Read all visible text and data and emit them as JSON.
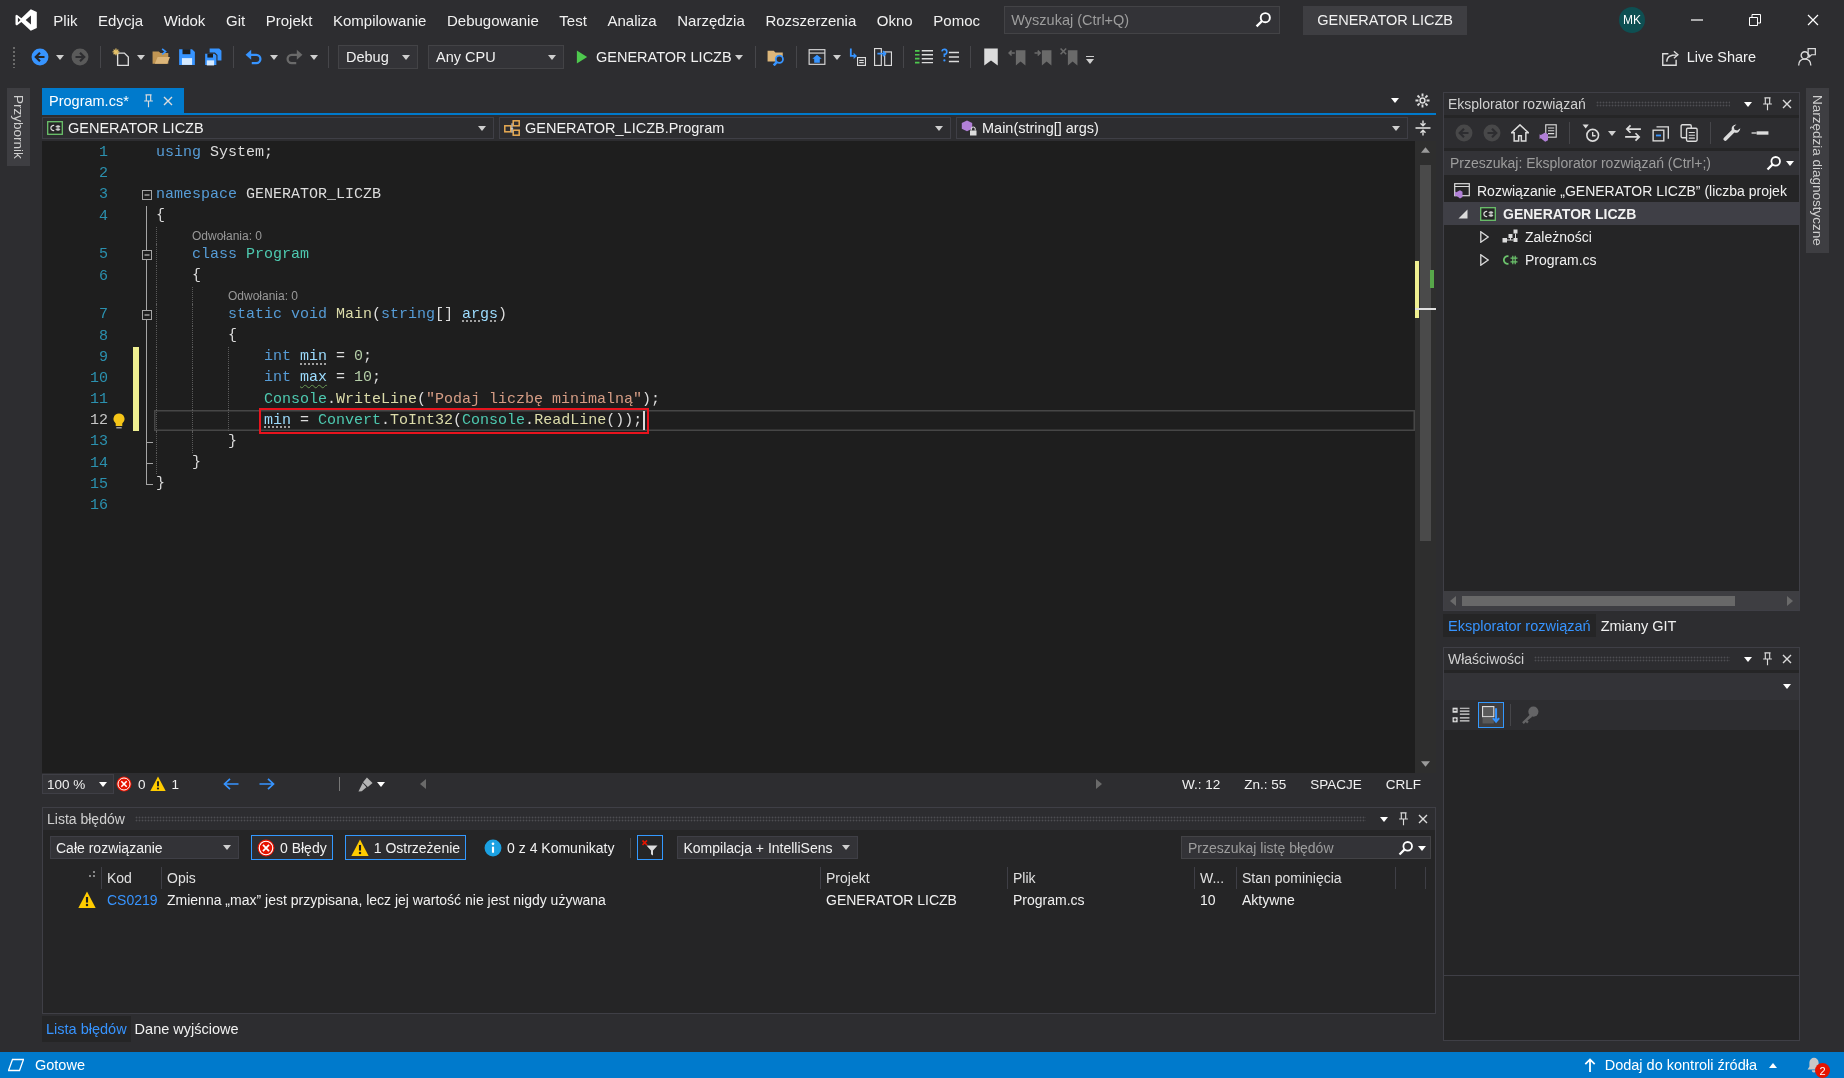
{
  "title_bar": {
    "menu": [
      "Plik",
      "Edycja",
      "Widok",
      "Git",
      "Projekt",
      "Kompilowanie",
      "Debugowanie",
      "Test",
      "Analiza",
      "Narzędzia",
      "Rozszerzenia",
      "Okno",
      "Pomoc"
    ],
    "search": {
      "placeholder": "Wyszukaj (Ctrl+Q)"
    },
    "solution_name": "GENERATOR LICZB",
    "avatar": "MK"
  },
  "toolbar": {
    "configuration": "Debug",
    "platform": "Any CPU",
    "start_target": "GENERATOR LICZB",
    "live_share": "Live Share"
  },
  "left_rail": {
    "label": "Przybornik"
  },
  "document_tabs": [
    {
      "label": "Program.cs*",
      "selected": true
    }
  ],
  "navigation_bar": {
    "project": "GENERATOR LICZB",
    "type": "GENERATOR_LICZB.Program",
    "member": "Main(string[] args)"
  },
  "editor": {
    "lines": [
      {
        "kind": "code",
        "number": "1",
        "modified": false,
        "tokens": [
          {
            "text": "using",
            "kind": "keyword"
          },
          {
            "text": " System;",
            "kind": "plain"
          }
        ]
      },
      {
        "kind": "code",
        "number": "2",
        "modified": false
      },
      {
        "kind": "code",
        "number": "3",
        "modified": false,
        "expanded": true,
        "tokens": [
          {
            "text": "namespace",
            "kind": "keyword"
          },
          {
            "text": " GENERATOR_LICZB",
            "kind": "plain"
          }
        ]
      },
      {
        "kind": "code",
        "number": "4",
        "modified": false,
        "tokens": [
          {
            "text": "{",
            "kind": "plain"
          }
        ]
      },
      {
        "kind": "codelens",
        "text": "    Odwołania: 0"
      },
      {
        "kind": "code",
        "number": "5",
        "modified": false,
        "expanded": true,
        "tokens": [
          {
            "text": "    class",
            "kind": "keyword"
          },
          {
            "text": " Program",
            "kind": "type"
          }
        ]
      },
      {
        "kind": "code",
        "number": "6",
        "modified": false,
        "tokens": [
          {
            "text": "    {",
            "kind": "plain"
          }
        ]
      },
      {
        "kind": "codelens",
        "text": "        Odwołania: 0"
      },
      {
        "kind": "code",
        "number": "7",
        "modified": false,
        "expanded": true,
        "tokens": [
          {
            "text": "        static void",
            "kind": "keyword"
          },
          {
            "text": " Main",
            "kind": "method"
          },
          {
            "text": "(",
            "kind": "plain"
          },
          {
            "text": "string",
            "kind": "keyword"
          },
          {
            "text": "[] ",
            "kind": "plain"
          },
          {
            "text": "args",
            "kind": "variable",
            "suggestion_dots": true
          },
          {
            "text": ")",
            "kind": "plain"
          }
        ]
      },
      {
        "kind": "code",
        "number": "8",
        "modified": false,
        "tokens": [
          {
            "text": "        {",
            "kind": "plain"
          }
        ]
      },
      {
        "kind": "code",
        "number": "9",
        "modified": true,
        "tokens": [
          {
            "text": "            int ",
            "kind": "keyword"
          },
          {
            "text": "min",
            "kind": "variable",
            "suggestion_dots": true
          },
          {
            "text": " = ",
            "kind": "plain"
          },
          {
            "text": "0",
            "kind": "number"
          },
          {
            "text": ";",
            "kind": "plain"
          }
        ]
      },
      {
        "kind": "code",
        "number": "10",
        "modified": true,
        "tokens": [
          {
            "text": "            int ",
            "kind": "keyword"
          },
          {
            "text": "max",
            "kind": "variable",
            "warning_squiggle": true
          },
          {
            "text": " = ",
            "kind": "plain"
          },
          {
            "text": "10",
            "kind": "number"
          },
          {
            "text": ";",
            "kind": "plain"
          }
        ]
      },
      {
        "kind": "code",
        "number": "11",
        "modified": true,
        "tokens": [
          {
            "text": "            Console",
            "kind": "type"
          },
          {
            "text": ".",
            "kind": "plain"
          },
          {
            "text": "WriteLine",
            "kind": "method"
          },
          {
            "text": "(",
            "kind": "plain"
          },
          {
            "text": "\"Podaj liczbę minimalną\"",
            "kind": "string"
          },
          {
            "text": ");",
            "kind": "plain"
          }
        ]
      },
      {
        "kind": "code",
        "number": "12",
        "modified": true,
        "current": true,
        "highlighted": true,
        "lightbulb": true,
        "tokens": [
          {
            "text": "            min",
            "kind": "variable",
            "suggestion_dots": true
          },
          {
            "text": " = ",
            "kind": "plain"
          },
          {
            "text": "Convert",
            "kind": "type"
          },
          {
            "text": ".",
            "kind": "plain"
          },
          {
            "text": "ToInt32",
            "kind": "method"
          },
          {
            "text": "(",
            "kind": "plain"
          },
          {
            "text": "Console",
            "kind": "type"
          },
          {
            "text": ".",
            "kind": "plain"
          },
          {
            "text": "ReadLine",
            "kind": "method"
          },
          {
            "text": "());",
            "kind": "plain"
          }
        ]
      },
      {
        "kind": "code",
        "number": "13",
        "modified": false,
        "fold_end": true,
        "tokens": [
          {
            "text": "        }",
            "kind": "plain"
          }
        ]
      },
      {
        "kind": "code",
        "number": "14",
        "modified": false,
        "fold_end": true,
        "tokens": [
          {
            "text": "    }",
            "kind": "plain"
          }
        ]
      },
      {
        "kind": "code",
        "number": "15",
        "modified": false,
        "fold_end": true,
        "tokens": [
          {
            "text": "}",
            "kind": "plain"
          }
        ]
      },
      {
        "kind": "code",
        "number": "16",
        "modified": false
      }
    ]
  },
  "editor_status": {
    "zoom": "100 %",
    "errors": "0",
    "warnings": "1",
    "line": "W.: 12",
    "column": "Zn.: 55",
    "indentation": "SPACJE",
    "line_endings": "CRLF"
  },
  "error_list": {
    "title": "Lista błędów",
    "scope": "Całe rozwiązanie",
    "filters": [
      {
        "kind": "error",
        "label": "0 Błędy",
        "selected": true
      },
      {
        "kind": "warning",
        "label": "1 Ostrzeżenie",
        "selected": true
      },
      {
        "kind": "info",
        "label": "0 z 4 Komunikaty",
        "selected": false
      }
    ],
    "filter_toggle": {
      "selected": true
    },
    "source": "Kompilacja + IntelliSens",
    "search": {
      "placeholder": "Przeszukaj listę błędów"
    },
    "columns": [
      "Kod",
      "Opis",
      "Projekt",
      "Plik",
      "W...",
      "Stan pominięcia"
    ],
    "rows": [
      {
        "kind": "warning",
        "code": "CS0219",
        "description": "Zmienna „max” jest przypisana, lecz jej wartość nie jest nigdy używana",
        "project": "GENERATOR LICZB",
        "file": "Program.cs",
        "line": "10",
        "suppression": "Aktywne",
        "selected": false
      }
    ]
  },
  "bottom_tabs": [
    {
      "label": "Lista błędów",
      "selected": true
    },
    {
      "label": "Dane wyjściowe",
      "selected": false
    }
  ],
  "solution_explorer": {
    "title": "Eksplorator rozwiązań",
    "search": {
      "placeholder": "Przeszukaj: Eksplorator rozwiązań (Ctrl+;)"
    },
    "tree": [
      {
        "kind": "solution",
        "label": "Rozwiązanie „GENERATOR LICZB” (liczba projek",
        "selected": false,
        "children": [
          {
            "kind": "project",
            "label": "GENERATOR LICZB",
            "selected": true,
            "expanded": true,
            "children": [
              {
                "kind": "dependencies",
                "label": "Zależności",
                "selected": false,
                "expanded": false
              },
              {
                "kind": "file",
                "label": "Program.cs",
                "selected": false,
                "expanded": false
              }
            ]
          }
        ]
      }
    ]
  },
  "side_tabs": [
    {
      "label": "Eksplorator rozwiązań",
      "selected": true
    },
    {
      "label": "Zmiany GIT",
      "selected": false
    }
  ],
  "properties": {
    "title": "Właściwości",
    "view_buttons": [
      {
        "kind": "categorized",
        "selected": false,
        "disabled": false
      },
      {
        "kind": "alphabetical",
        "selected": true,
        "disabled": false
      },
      {
        "kind": "property_pages",
        "selected": false,
        "disabled": true
      }
    ]
  },
  "right_rail": {
    "label": "Narzędzia diagnostyczne"
  },
  "status_bar": {
    "message": "Gotowe",
    "source_control": "Dodaj do kontroli źródła",
    "notifications": "2"
  }
}
